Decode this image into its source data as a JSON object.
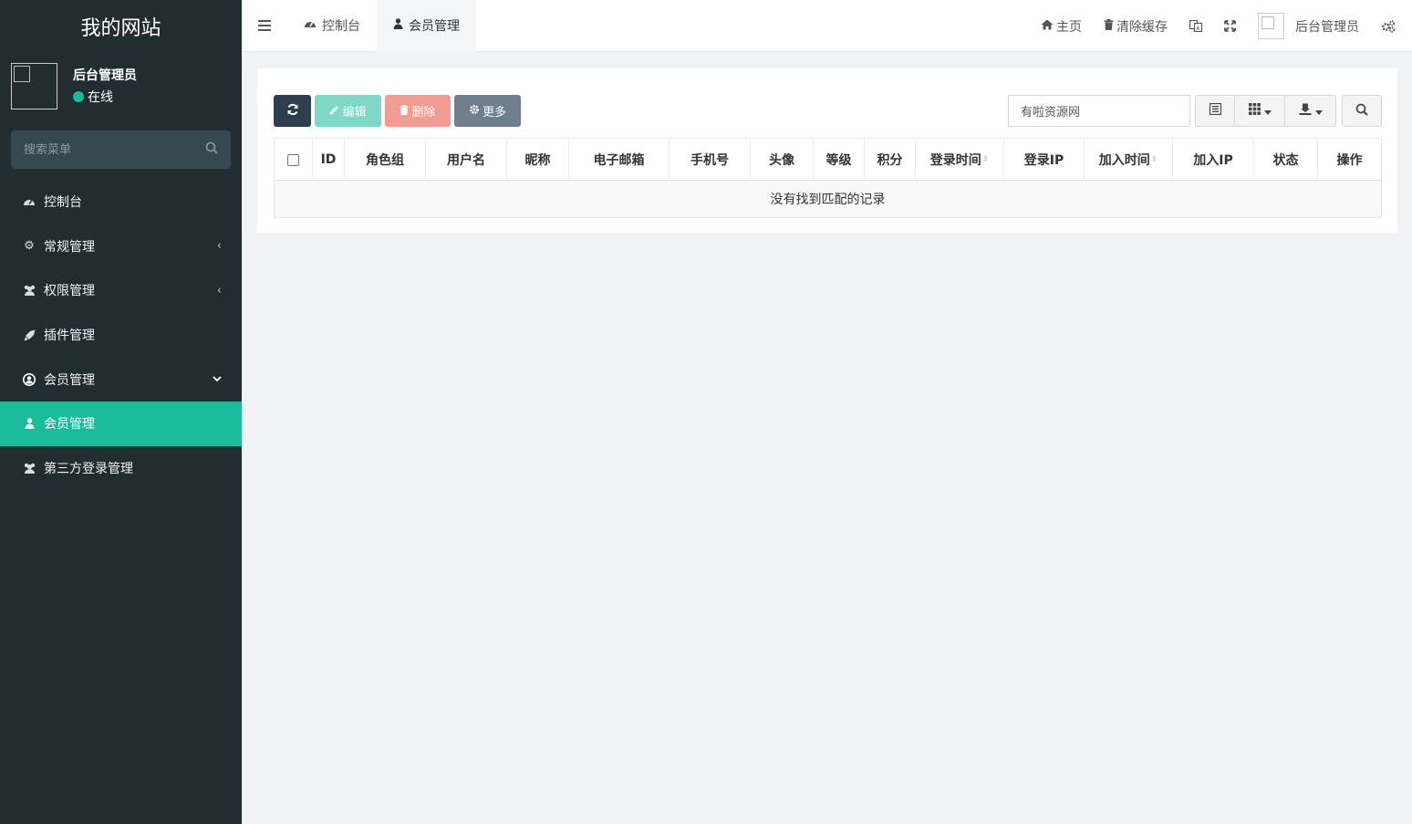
{
  "sidebar": {
    "site_title": "我的网站",
    "user_name": "后台管理员",
    "user_status": "在线",
    "search_placeholder": "搜索菜单",
    "items": [
      {
        "label": "控制台",
        "icon": "dashboard-icon"
      },
      {
        "label": "常规管理",
        "icon": "cogs-icon",
        "arrow": "‹"
      },
      {
        "label": "权限管理",
        "icon": "users-icon",
        "arrow": "‹"
      },
      {
        "label": "插件管理",
        "icon": "rocket-icon"
      },
      {
        "label": "会员管理",
        "icon": "user-circle-icon",
        "arrow": "⌄"
      },
      {
        "label": "会员管理",
        "icon": "user-icon",
        "active": true
      },
      {
        "label": "第三方登录管理",
        "icon": "users-icon"
      }
    ]
  },
  "topbar": {
    "tabs": [
      {
        "label": "控制台",
        "icon": "dashboard-icon"
      },
      {
        "label": "会员管理",
        "icon": "user-icon",
        "active": true
      }
    ],
    "home_label": "主页",
    "clear_cache_label": "清除缓存",
    "admin_name": "后台管理员"
  },
  "toolbar": {
    "edit_label": "编辑",
    "delete_label": "删除",
    "more_label": "更多",
    "search_value": "有啦资源网"
  },
  "table": {
    "columns": [
      "ID",
      "角色组",
      "用户名",
      "昵称",
      "电子邮箱",
      "手机号",
      "头像",
      "等级",
      "积分",
      "登录时间",
      "登录IP",
      "加入时间",
      "加入IP",
      "状态",
      "操作"
    ],
    "empty_message": "没有找到匹配的记录"
  },
  "colors": {
    "sidebar_bg": "#222d32",
    "accent": "#1abc9c",
    "primary": "#2c3e50",
    "danger": "#f29b93"
  }
}
